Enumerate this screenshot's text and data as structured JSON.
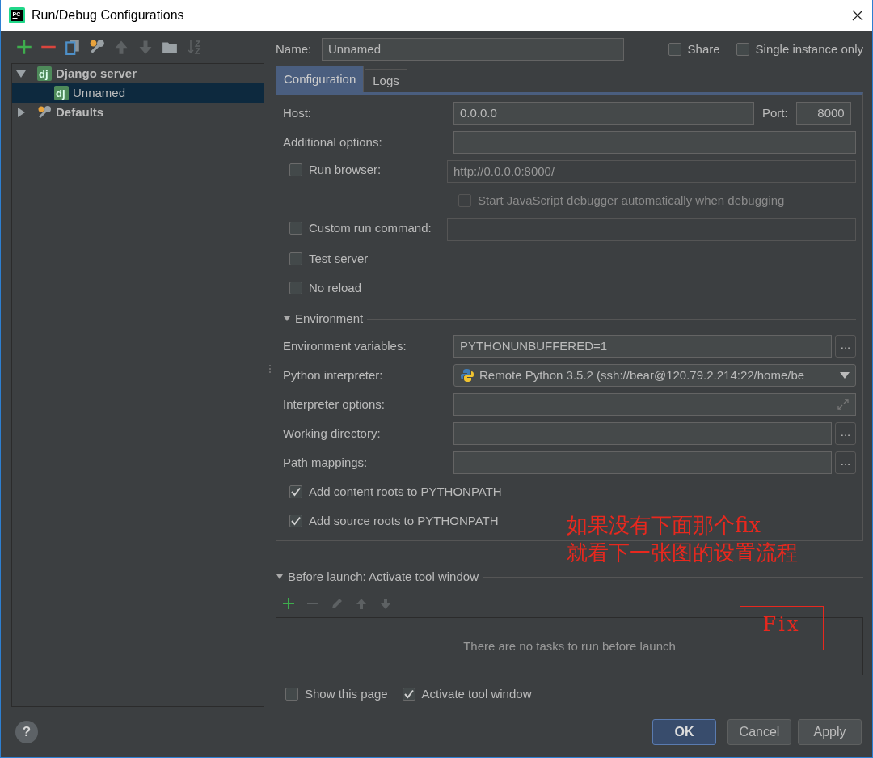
{
  "window": {
    "title": "Run/Debug Configurations",
    "logo_text": "PC"
  },
  "toolbar": [
    {
      "kind": "add",
      "disabled": false
    },
    {
      "kind": "remove",
      "disabled": false
    },
    {
      "kind": "copy",
      "disabled": false
    },
    {
      "kind": "wrench",
      "disabled": false
    },
    {
      "kind": "up",
      "disabled": true
    },
    {
      "kind": "down",
      "disabled": true
    },
    {
      "kind": "folder",
      "disabled": false
    },
    {
      "kind": "sort",
      "disabled": true
    }
  ],
  "tree": [
    {
      "label": "Django server",
      "kind": "django",
      "icon_text": "dj",
      "expanded": true,
      "selected": false,
      "children": [
        {
          "label": "Unnamed",
          "kind": "django",
          "icon_text": "dj",
          "selected": true
        }
      ]
    },
    {
      "label": "Defaults",
      "kind": "defaults",
      "expanded": false,
      "selected": false
    }
  ],
  "name": {
    "label": "Name:",
    "value": "Unnamed"
  },
  "header_options": [
    {
      "label": "Share",
      "checked": false
    },
    {
      "label": "Single instance only",
      "checked": false
    }
  ],
  "tabs": [
    {
      "label": "Configuration",
      "selected": true
    },
    {
      "label": "Logs",
      "selected": false
    }
  ],
  "config_rows": [
    {
      "kind": "host",
      "label": "Host:",
      "value": "0.0.0.0",
      "port_label": "Port:",
      "port_value": "8000"
    },
    {
      "kind": "field",
      "label": "Additional options:"
    },
    {
      "kind": "check_field",
      "label": "Run browser:",
      "checked": false,
      "value": "http://0.0.0.0:8000/"
    },
    {
      "kind": "subcheck",
      "label": "Start JavaScript debugger automatically when debugging",
      "checked": false,
      "disabled": true
    },
    {
      "kind": "check_field",
      "label": "Custom run command:",
      "checked": false
    },
    {
      "kind": "check",
      "label": "Test server",
      "checked": false
    },
    {
      "kind": "check",
      "label": "No reload",
      "checked": false
    },
    {
      "kind": "section",
      "label": "Environment",
      "expanded": true
    },
    {
      "kind": "field",
      "label": "Environment variables:",
      "value": "PYTHONUNBUFFERED=1",
      "browse": "..."
    },
    {
      "kind": "select",
      "label": "Python interpreter:",
      "value": "Remote Python 3.5.2 (ssh://bear@120.79.2.214:22/home/be"
    },
    {
      "kind": "expand_field",
      "label": "Interpreter options:"
    },
    {
      "kind": "field",
      "label": "Working directory:",
      "browse": "..."
    },
    {
      "kind": "field",
      "label": "Path mappings:",
      "browse": "..."
    },
    {
      "kind": "check",
      "label": "Add content roots to PYTHONPATH",
      "checked": true
    },
    {
      "kind": "check",
      "label": "Add source roots to PYTHONPATH",
      "checked": true
    }
  ],
  "before_launch": {
    "label": "Before launch: Activate tool window",
    "expanded": true,
    "toolbar": [
      {
        "kind": "add",
        "disabled": false
      },
      {
        "kind": "remove",
        "disabled": true
      },
      {
        "kind": "edit",
        "disabled": true
      },
      {
        "kind": "up",
        "disabled": true
      },
      {
        "kind": "down",
        "disabled": true
      }
    ],
    "empty_text": "There are no tasks to run before launch"
  },
  "bottom_options": [
    {
      "label": "Show this page",
      "checked": false
    },
    {
      "label": "Activate tool window",
      "checked": true
    }
  ],
  "help": "?",
  "buttons": [
    {
      "label": "OK",
      "kind": "default"
    },
    {
      "label": "Cancel",
      "kind": "normal"
    },
    {
      "label": "Apply",
      "kind": "normal"
    }
  ],
  "annotations": [
    {
      "kind": "note",
      "lines": [
        "如果没有下面那个fix",
        "就看下一张图的设置流程"
      ]
    },
    {
      "kind": "box",
      "text": "Fix"
    }
  ]
}
